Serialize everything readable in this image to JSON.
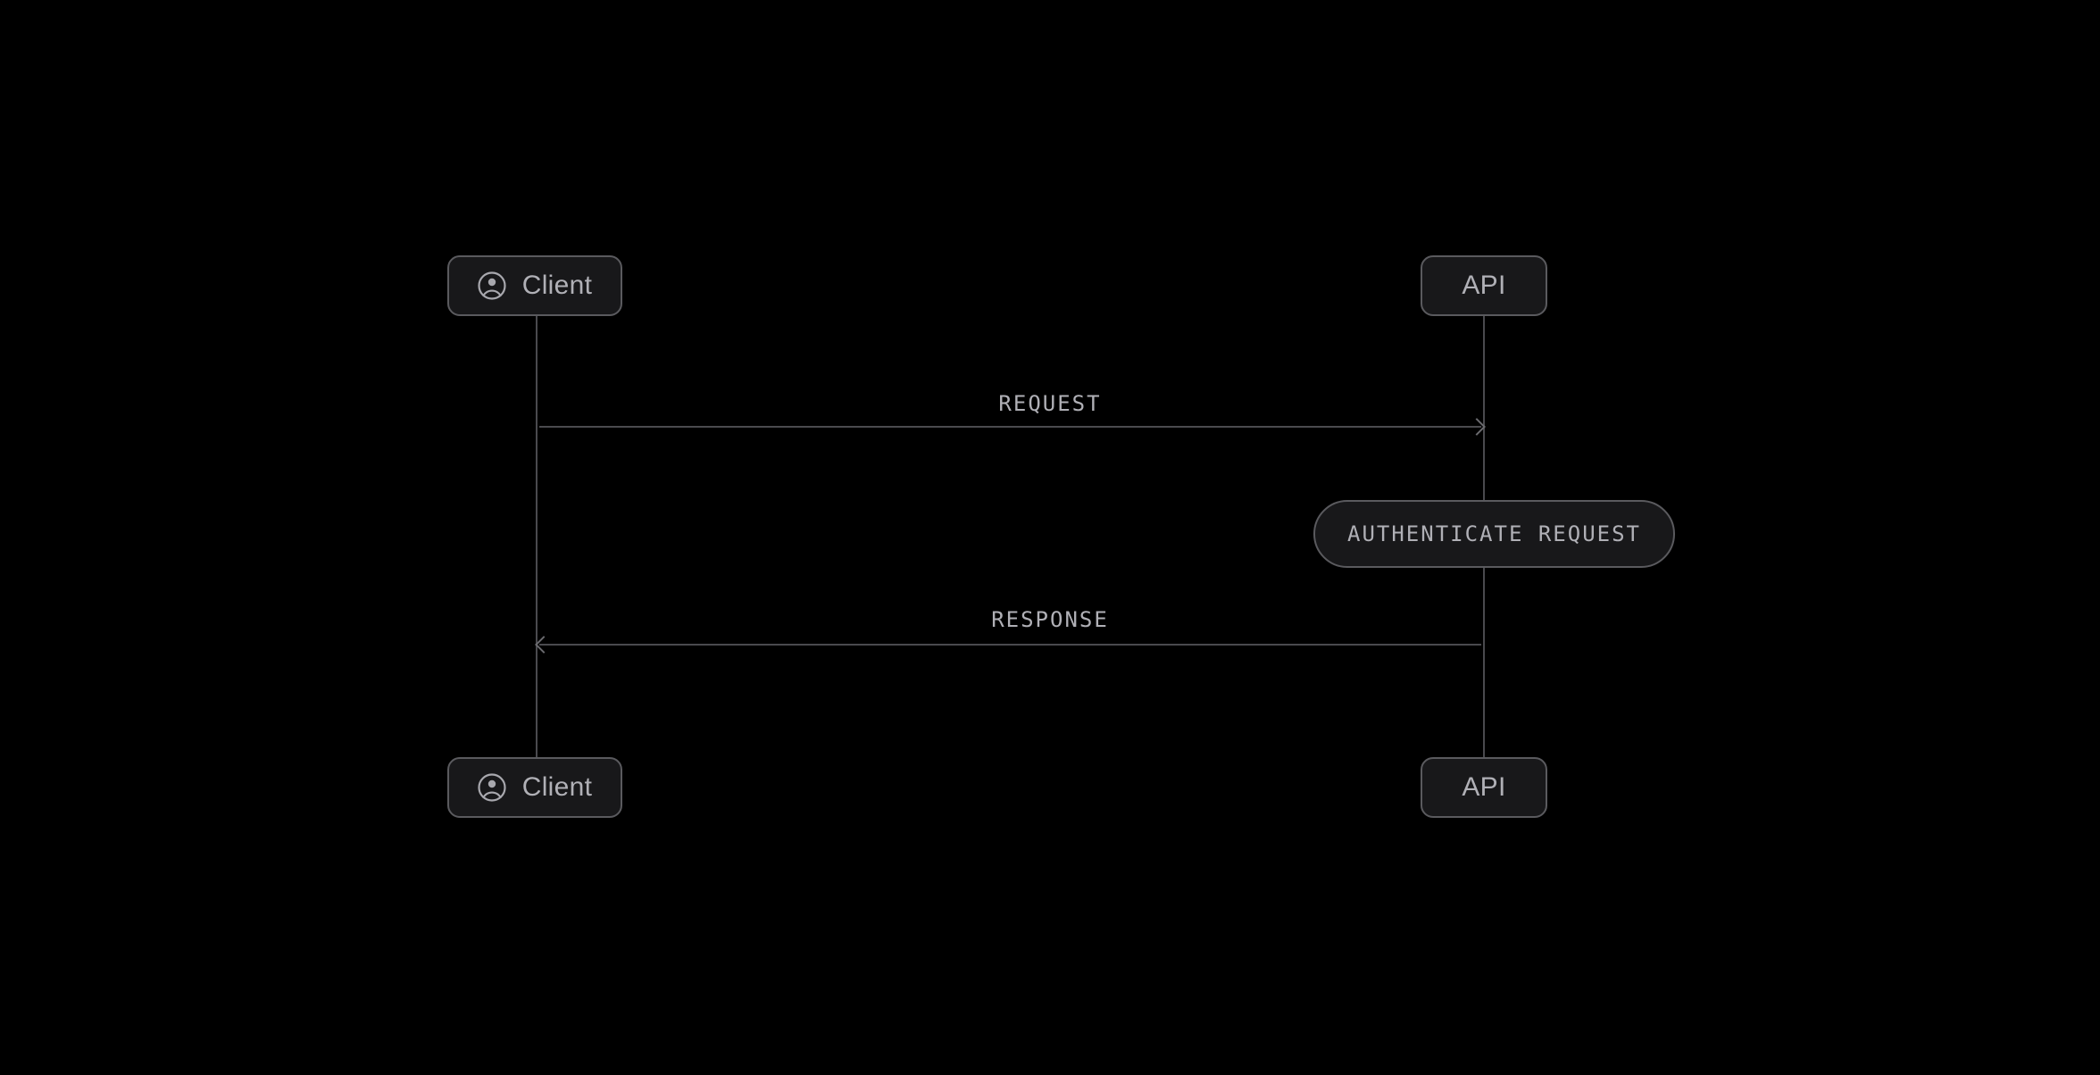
{
  "actors": {
    "client": {
      "label": "Client"
    },
    "api": {
      "label": "API"
    }
  },
  "messages": {
    "request": {
      "label": "REQUEST"
    },
    "response": {
      "label": "RESPONSE"
    }
  },
  "activation": {
    "authenticate": {
      "label": "AUTHENTICATE REQUEST"
    }
  }
}
